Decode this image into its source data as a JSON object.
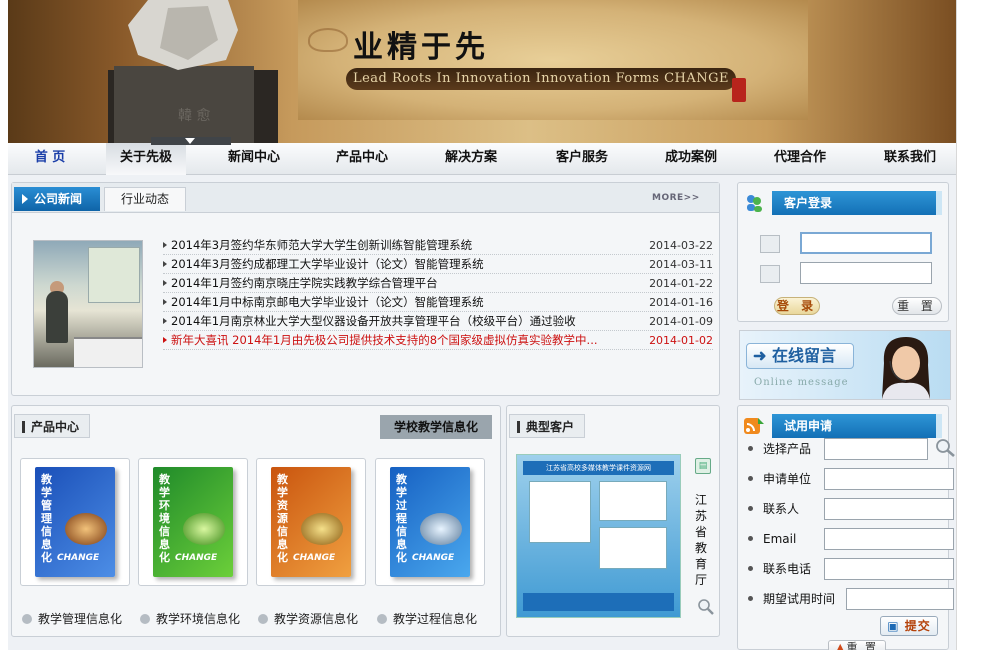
{
  "banner": {
    "title": "业精于先",
    "slogan": "Lead Roots In Innovation Innovation Forms CHANGE"
  },
  "nav": {
    "items": [
      {
        "label": "首 页"
      },
      {
        "label": "关于先极"
      },
      {
        "label": "新闻中心"
      },
      {
        "label": "产品中心"
      },
      {
        "label": "解决方案"
      },
      {
        "label": "客户服务"
      },
      {
        "label": "成功案例"
      },
      {
        "label": "代理合作"
      },
      {
        "label": "联系我们"
      }
    ]
  },
  "news": {
    "tab_active": "公司新闻",
    "tab_other": "行业动态",
    "more": "MORE>>",
    "items": [
      {
        "title": "2014年3月签约华东师范大学大学生创新训练智能管理系统",
        "date": "2014-03-22"
      },
      {
        "title": "2014年3月签约成都理工大学毕业设计（论文）智能管理系统",
        "date": "2014-03-11"
      },
      {
        "title": "2014年1月签约南京晓庄学院实践教学综合管理平台",
        "date": "2014-01-22"
      },
      {
        "title": "2014年1月中标南京邮电大学毕业设计（论文）智能管理系统",
        "date": "2014-01-16"
      },
      {
        "title": "2014年1月南京林业大学大型仪器设备开放共享管理平台（校级平台）通过验收",
        "date": "2014-01-09"
      },
      {
        "title": "新年大喜讯 2014年1月由先极公司提供技术支持的8个国家级虚拟仿真实验教学中...",
        "date": "2014-01-02"
      }
    ]
  },
  "products": {
    "title": "产品中心",
    "tag": "学校教学信息化",
    "items": [
      {
        "box_text": "教学管理信息化",
        "label": "教学管理信息化",
        "brand": "CHANGE"
      },
      {
        "box_text": "教学环境信息化",
        "label": "教学环境信息化",
        "brand": "CHANGE"
      },
      {
        "box_text": "教学资源信息化",
        "label": "教学资源信息化",
        "brand": "CHANGE"
      },
      {
        "box_text": "教学过程信息化",
        "label": "教学过程信息化",
        "brand": "CHANGE"
      }
    ]
  },
  "clients": {
    "title": "典型客户",
    "shot_header": "江苏省高校多媒体教学课件资源网",
    "name": "江苏省教育厅"
  },
  "login": {
    "title": "客户登录",
    "login_label": "登 录",
    "reset_label": "重 置"
  },
  "message": {
    "title": "在线留言",
    "subtitle": "Online message"
  },
  "trial": {
    "title": "试用申请",
    "fields": [
      {
        "label": "选择产品"
      },
      {
        "label": "申请单位"
      },
      {
        "label": "联系人"
      },
      {
        "label": "Email"
      },
      {
        "label": "联系电话"
      },
      {
        "label": "期望试用时间"
      }
    ],
    "submit_label": "提交",
    "reset_label": "重 置"
  },
  "colors": {
    "accent": "#1370b6",
    "nav_home": "#1a3ea8",
    "news_highlight": "#cc1111"
  }
}
